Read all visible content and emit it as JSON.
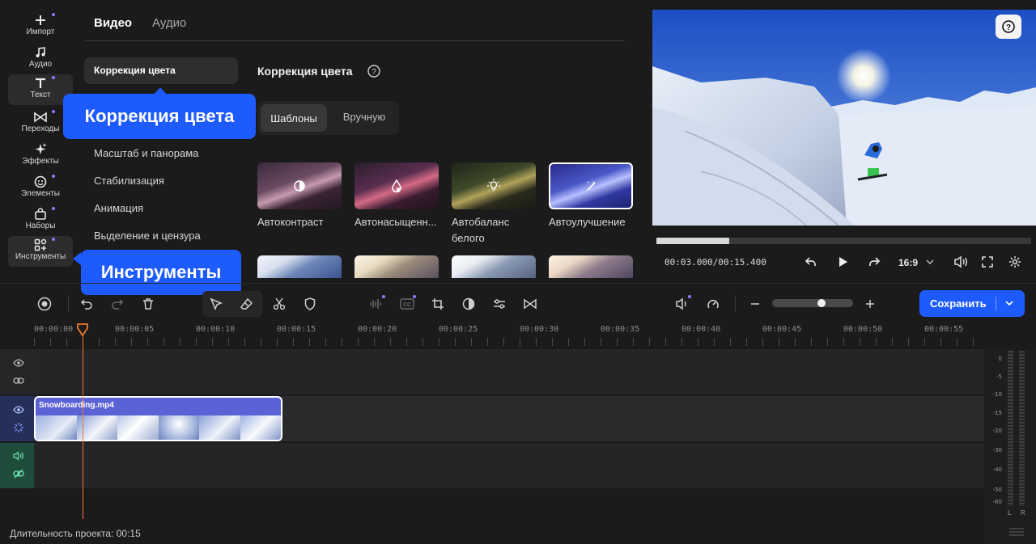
{
  "rail": {
    "items": [
      {
        "label": "Импорт",
        "icon": "plus-icon"
      },
      {
        "label": "Аудио",
        "icon": "music-note-icon"
      },
      {
        "label": "Текст",
        "icon": "text-t-icon"
      },
      {
        "label": "Переходы",
        "icon": "transitions-icon"
      },
      {
        "label": "Эффекты",
        "icon": "sparkle-icon"
      },
      {
        "label": "Элементы",
        "icon": "smiley-icon"
      },
      {
        "label": "Наборы",
        "icon": "bag-icon"
      },
      {
        "label": "Инструменты",
        "icon": "tools-grid-icon"
      }
    ]
  },
  "panel": {
    "tabs": {
      "video": "Видео",
      "audio": "Аудио"
    },
    "menu": {
      "color_correction": "Коррекция цвета",
      "scale_pan": "Масштаб и панорама",
      "stabilization": "Стабилизация",
      "animation": "Анимация",
      "highlight_censor": "Выделение и цензура"
    },
    "heading": "Коррекция цвета",
    "modes": {
      "templates": "Шаблоны",
      "manual": "Вручную"
    },
    "presets": [
      {
        "label": "Автоконтраст",
        "icon": "contrast-icon"
      },
      {
        "label": "Автонасыщенн...",
        "icon": "drop-icon"
      },
      {
        "label": "Автобаланс белого",
        "icon": "bulb-icon"
      },
      {
        "label": "Автоулучшение",
        "icon": "magic-wand-icon"
      }
    ]
  },
  "tooltips": {
    "color": "Коррекция цвета",
    "tools": "Инструменты"
  },
  "player": {
    "current": "00:03.000",
    "separator": "/",
    "total": "00:15.400",
    "aspect": "16:9",
    "progress": 0.195
  },
  "toolbar": {
    "save_label": "Сохранить"
  },
  "ruler": [
    "00:00:00",
    "00:00:05",
    "00:00:10",
    "00:00:15",
    "00:00:20",
    "00:00:25",
    "00:00:30",
    "00:00:35",
    "00:00:40",
    "00:00:45",
    "00:00:50",
    "00:00:55"
  ],
  "clip": {
    "name": "Snowboarding.mp4"
  },
  "meter": {
    "labels": [
      "0",
      "-5",
      "-10",
      "-15",
      "-20",
      "-30",
      "-40",
      "-50",
      "-60"
    ],
    "left": "L",
    "right": "R"
  },
  "status": {
    "duration": "Длительность проекта: 00:15"
  },
  "colors": {
    "accent": "#1e5bff",
    "playhead": "#f07a2a",
    "clip": "#5b62d6",
    "audio_track": "#1f4d3c"
  }
}
